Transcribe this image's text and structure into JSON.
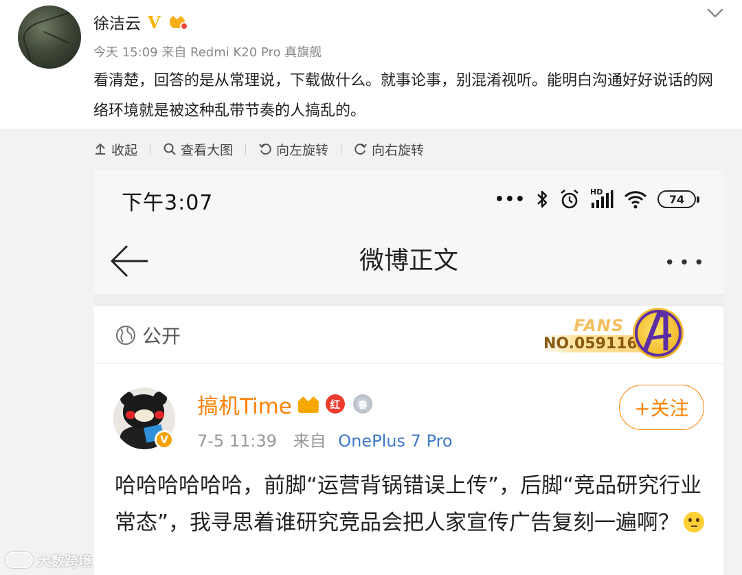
{
  "comment": {
    "user_name": "徐洁云",
    "verified_mark": "V",
    "meta": "今天 15:09 来自 Redmi K20 Pro 真旗舰",
    "text": "看清楚，回答的是从常理说，下载做什么。就事论事，别混淆视听。能明白沟通好好说话的网络环境就是被这种乱带节奏的人搞乱的。"
  },
  "preview_toolbar": {
    "collapse": "收起",
    "view_large": "查看大图",
    "rotate_left": "向左旋转",
    "rotate_right": "向右旋转"
  },
  "phone": {
    "status_time": "下午3:07",
    "status_dots": "•••",
    "signal_tag": "HD",
    "battery": "74",
    "nav_title": "微博正文",
    "nav_more": "•••",
    "privacy": "公开",
    "fans_badge": {
      "word": "FANS",
      "number": "NO.0591162"
    },
    "post": {
      "author": "搞机Time",
      "red_medal": "红",
      "silver_medal": "春",
      "v_badge": "V",
      "time": "7-5 11:39",
      "source_prefix": "来自",
      "device": "OnePlus 7 Pro",
      "follow_label": "+关注",
      "text": "哈哈哈哈哈哈，前脚“运营背锅错误上传”，后脚“竞品研究行业常态”，我寻思着谁研究竞品会把人家宣传广告复刻一遍啊？"
    }
  },
  "watermark": "大数跨境",
  "colors": {
    "accent_orange": "#ff8200",
    "link_blue": "#3c78c8",
    "verified_gold": "#f6b400"
  },
  "icons": [
    "chevron-down-icon",
    "collapse-arrow-icon",
    "magnifier-icon",
    "rotate-left-icon",
    "rotate-right-icon",
    "bluetooth-icon",
    "alarm-icon",
    "signal-icon",
    "wifi-icon",
    "battery-icon",
    "back-arrow-icon",
    "globe-icon",
    "think-emoji-icon"
  ]
}
